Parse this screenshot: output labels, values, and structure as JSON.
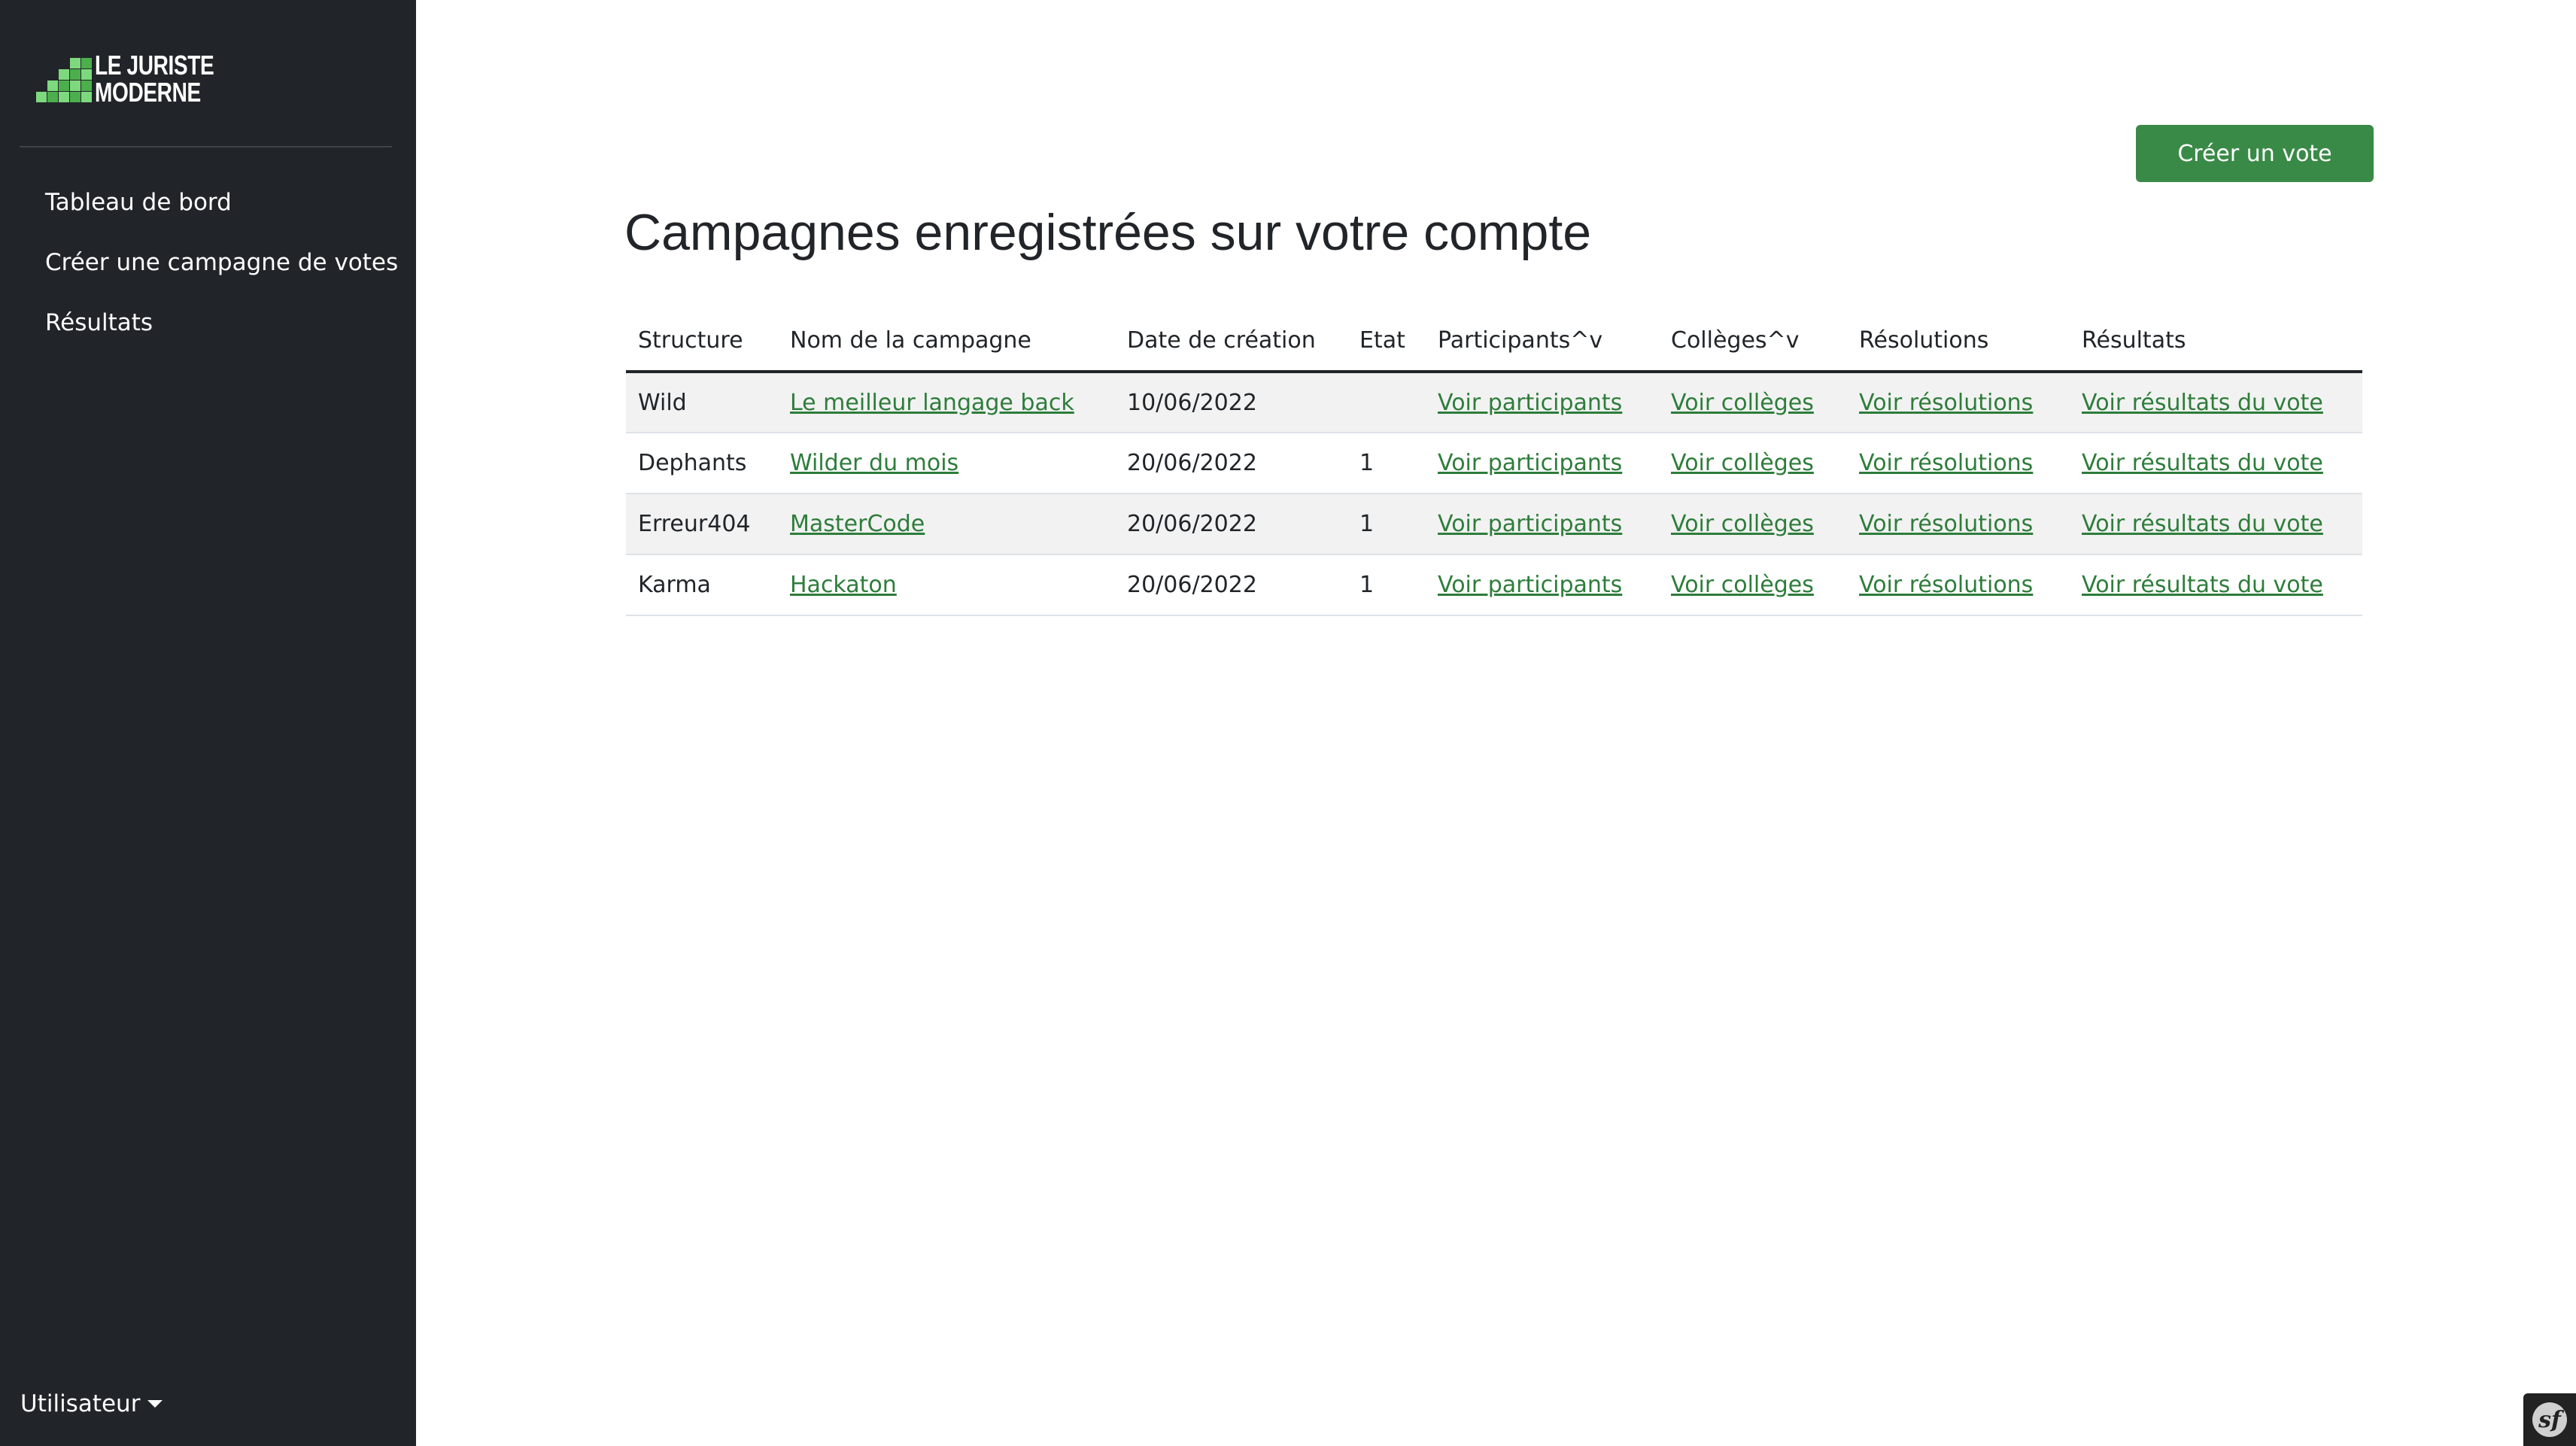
{
  "brand": {
    "line1": "LE JURISTE",
    "line2": "MODERNE"
  },
  "sidebar": {
    "items": [
      {
        "label": "Tableau de bord"
      },
      {
        "label": "Créer une campagne de votes"
      },
      {
        "label": "Résultats"
      }
    ],
    "user_menu_label": "Utilisateur"
  },
  "main": {
    "create_button_label": "Créer un vote",
    "title": "Campagnes enregistrées sur votre compte"
  },
  "table": {
    "headers": {
      "structure": "Structure",
      "name": "Nom de la campagne",
      "date": "Date de création",
      "state": "Etat",
      "participants": "Participants^v",
      "colleges": "Collèges^v",
      "resolutions": "Résolutions",
      "results": "Résultats"
    },
    "rows": [
      {
        "structure": "Wild",
        "name": "Le meilleur langage back",
        "date": "10/06/2022",
        "state": "",
        "participants": "Voir participants",
        "colleges": "Voir collèges",
        "resolutions": "Voir résolutions",
        "results": "Voir résultats du vote"
      },
      {
        "structure": "Dephants",
        "name": "Wilder du mois",
        "date": "20/06/2022",
        "state": "1",
        "participants": "Voir participants",
        "colleges": "Voir collèges",
        "resolutions": "Voir résolutions",
        "results": "Voir résultats du vote"
      },
      {
        "structure": "Erreur404",
        "name": "MasterCode",
        "date": "20/06/2022",
        "state": "1",
        "participants": "Voir participants",
        "colleges": "Voir collèges",
        "resolutions": "Voir résolutions",
        "results": "Voir résultats du vote"
      },
      {
        "structure": "Karma",
        "name": "Hackaton",
        "date": "20/06/2022",
        "state": "1",
        "participants": "Voir participants",
        "colleges": "Voir collèges",
        "resolutions": "Voir résolutions",
        "results": "Voir résultats du vote"
      }
    ]
  },
  "colors": {
    "sidebar_bg": "#212529",
    "accent_green": "#3a8a47",
    "link_green": "#2e7d3b"
  },
  "icons": {
    "logo": "bar-chart-logo-icon",
    "user_caret": "caret-down-icon",
    "debug_toolbar": "symfony-icon"
  }
}
